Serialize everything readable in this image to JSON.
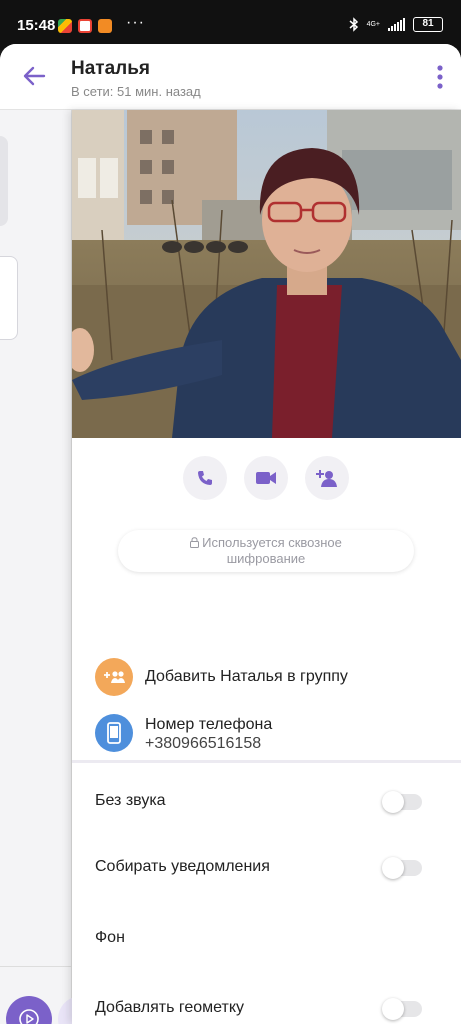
{
  "status_bar": {
    "time": "15:48",
    "battery": "81",
    "network": "4G+",
    "more": "···"
  },
  "header": {
    "title": "Наталья",
    "subtitle": "В сети: 51 мин. назад"
  },
  "actions": {
    "call_icon": "phone-icon",
    "video_icon": "video-camera-icon",
    "add_icon": "add-person-icon"
  },
  "encryption": {
    "line1": "Используется сквозное",
    "line2": "шифрование"
  },
  "info": {
    "add_to_group": "Добавить Наталья в группу",
    "phone_label": "Номер телефона",
    "phone_number": "+380966516158"
  },
  "settings": [
    {
      "label": "Без звука",
      "enabled": false
    },
    {
      "label": "Собирать уведомления",
      "enabled": false
    },
    {
      "label": "Фон"
    },
    {
      "label": "Добавлять геометку",
      "enabled": false
    }
  ],
  "colors": {
    "accent": "#7b61c9",
    "group_icon": "#f3a85a",
    "phone_icon": "#4e8fdc"
  }
}
